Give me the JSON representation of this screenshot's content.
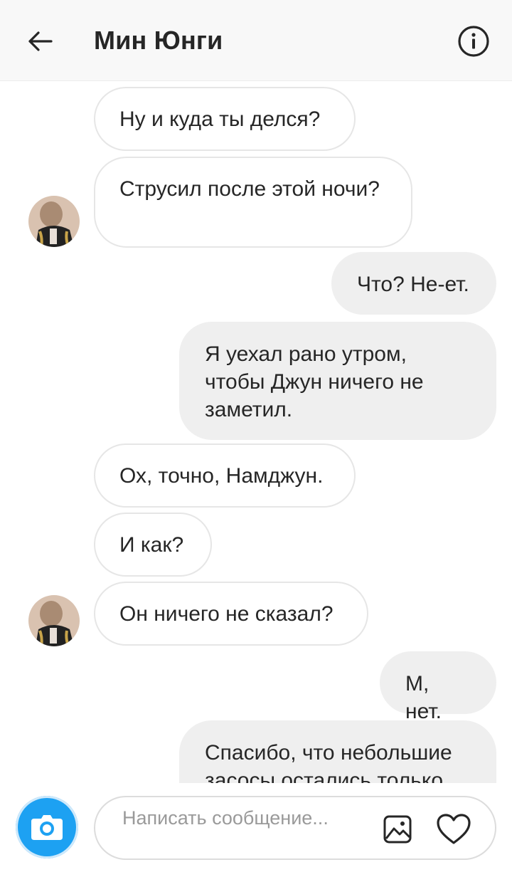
{
  "header": {
    "title": "Мин Юнги",
    "back_icon": "arrow-left-icon",
    "info_icon": "info-circle-icon"
  },
  "messages": [
    {
      "side": "in",
      "text": "Ну и куда ты делся?"
    },
    {
      "side": "in",
      "text": "Струсил после этой ночи?"
    },
    {
      "side": "out",
      "text": "Что? Не-ет."
    },
    {
      "side": "out",
      "text": "Я уехал рано утром, чтобы Джун ничего не заметил."
    },
    {
      "side": "in",
      "text": "Ох, точно, Намджун."
    },
    {
      "side": "in",
      "text": "И как?"
    },
    {
      "side": "in",
      "text": "Он ничего не сказал?"
    },
    {
      "side": "out",
      "text": "М, нет."
    },
    {
      "side": "out",
      "text": "Спасибо, что небольшие засосы остались только"
    }
  ],
  "composer": {
    "placeholder": "Написать сообщение...",
    "camera_icon": "camera-icon",
    "gallery_icon": "image-gallery-icon",
    "like_icon": "heart-icon",
    "camera_color": "#1da1f2"
  }
}
